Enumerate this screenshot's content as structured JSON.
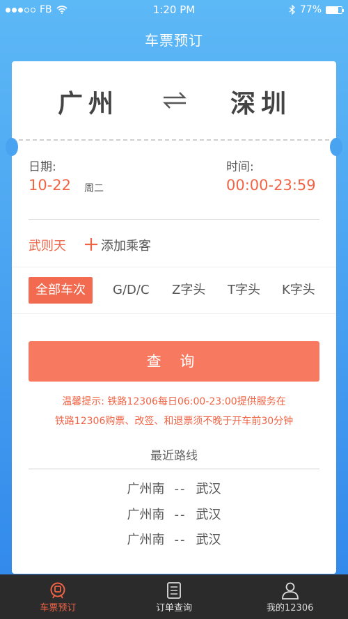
{
  "status_bar": {
    "carrier": "FB",
    "time": "1:20 PM",
    "battery": "77%",
    "battery_level": 0.77
  },
  "nav": {
    "title": "车票预订"
  },
  "ticket": {
    "from_station": "广州",
    "to_station": "深圳",
    "swap_icon": "swap-arrows-icon"
  },
  "date": {
    "label": "日期:",
    "value": "10-22",
    "weekday": "周二"
  },
  "time_range": {
    "label": "时间:",
    "value": "00:00-23:59"
  },
  "passenger": {
    "name": "武则天",
    "add_label": "添加乘客"
  },
  "filters": [
    "全部车次",
    "G/D/C",
    "Z字头",
    "T字头",
    "K字头"
  ],
  "search_button": "查 询",
  "tips": [
    "温馨提示: 铁路12306每日06:00-23:00提供服务在",
    "铁路12306购票、改签、和退票须不晚于开车前30分钟"
  ],
  "recent": {
    "title": "最近路线",
    "routes": [
      {
        "from": "广州南",
        "sep": "--",
        "to": "武汉"
      },
      {
        "from": "广州南",
        "sep": "--",
        "to": "武汉"
      },
      {
        "from": "广州南",
        "sep": "--",
        "to": "武汉"
      }
    ]
  },
  "tab_bar": [
    {
      "label": "车票预订",
      "icon": "train-icon",
      "active": true
    },
    {
      "label": "订单查询",
      "icon": "order-list-icon",
      "active": false
    },
    {
      "label": "我的12306",
      "icon": "user-icon",
      "active": false
    }
  ],
  "colors": {
    "accent": "#f06446",
    "primary_blue": "#4aa3f1",
    "tab_bar_bg": "#2b2b2b"
  }
}
